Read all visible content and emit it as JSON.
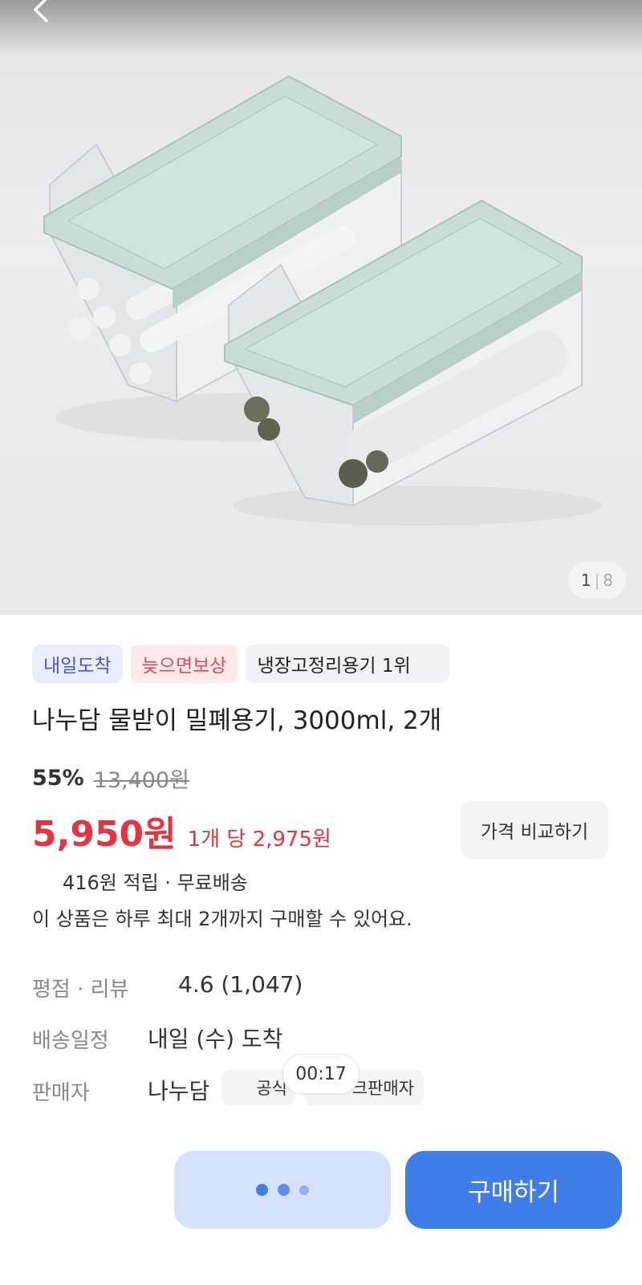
{
  "image": {
    "counter_current": "1",
    "counter_sep": "|",
    "counter_total": "8"
  },
  "badges": [
    {
      "label": "내일도착"
    },
    {
      "label": "늦으면보상"
    },
    {
      "label": "냉장고정리용기 1위"
    }
  ],
  "product": {
    "title": "나누담 물받이 밀폐용기, 3000ml, 2개",
    "discount": "55%",
    "original_price": "13,400원",
    "price": "5,950원",
    "unit_price": "1개 당 2,975원",
    "compare_label": "가격 비교하기",
    "shipping": "416원 적립 · 무료배송",
    "purchase_limit": "이 상품은 하루 최대 2개까지 구매할 수 있어요."
  },
  "info": {
    "rating_label": "평점 · 리뷰",
    "rating_value": "4.6 (1,047)",
    "delivery_label": "배송일정",
    "delivery_value": "내일 (수) 도착",
    "seller_label": "판매자",
    "seller_value": "나누담",
    "chip1": "공식",
    "chip2": "크판매자"
  },
  "timer": "00:17",
  "actions": {
    "buy_label": "구매하기"
  },
  "colors": {
    "accent": "#3f7de8",
    "price_red": "#e3343f"
  }
}
